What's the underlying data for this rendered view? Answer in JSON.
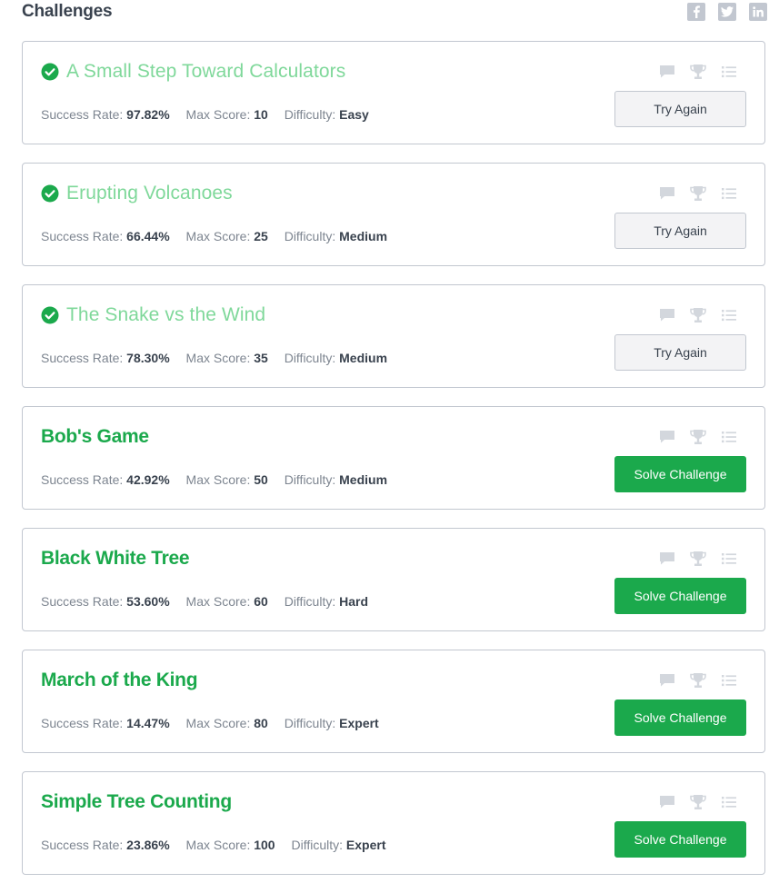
{
  "header": {
    "title": "Challenges",
    "social": [
      "facebook-icon",
      "twitter-icon",
      "linkedin-icon"
    ]
  },
  "labels": {
    "success_rate": "Success Rate:",
    "max_score": "Max Score:",
    "difficulty": "Difficulty:"
  },
  "colors": {
    "accent": "#1ba94c",
    "solved_title": "#7fd89a",
    "icon_gray": "#c2c7d0"
  },
  "challenges": [
    {
      "title": "A Small Step Toward Calculators",
      "solved": true,
      "success_rate": "97.82%",
      "max_score": "10",
      "difficulty": "Easy",
      "button": "Try Again"
    },
    {
      "title": "Erupting Volcanoes",
      "solved": true,
      "success_rate": "66.44%",
      "max_score": "25",
      "difficulty": "Medium",
      "button": "Try Again"
    },
    {
      "title": "The Snake vs the Wind",
      "solved": true,
      "success_rate": "78.30%",
      "max_score": "35",
      "difficulty": "Medium",
      "button": "Try Again"
    },
    {
      "title": "Bob's Game",
      "solved": false,
      "success_rate": "42.92%",
      "max_score": "50",
      "difficulty": "Medium",
      "button": "Solve Challenge"
    },
    {
      "title": "Black White Tree",
      "solved": false,
      "success_rate": "53.60%",
      "max_score": "60",
      "difficulty": "Hard",
      "button": "Solve Challenge"
    },
    {
      "title": "March of the King",
      "solved": false,
      "success_rate": "14.47%",
      "max_score": "80",
      "difficulty": "Expert",
      "button": "Solve Challenge"
    },
    {
      "title": "Simple Tree Counting",
      "solved": false,
      "success_rate": "23.86%",
      "max_score": "100",
      "difficulty": "Expert",
      "button": "Solve Challenge"
    }
  ],
  "card_icons": [
    "discussion-icon",
    "leaderboard-icon",
    "submissions-icon"
  ]
}
